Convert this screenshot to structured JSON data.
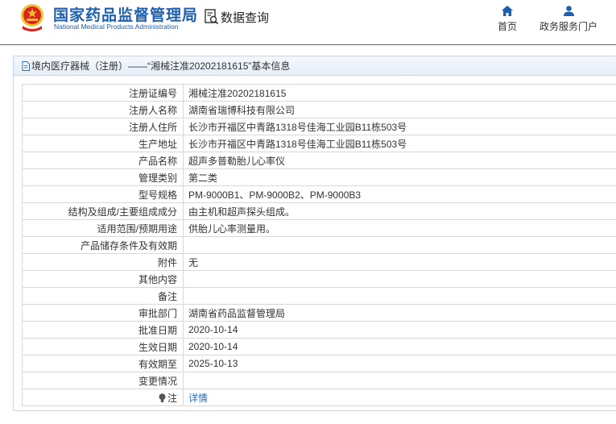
{
  "colors": {
    "brand": "#1d5fb0",
    "link": "#2a6ab8",
    "emblem_red": "#d9261c",
    "emblem_gold": "#f2c12e"
  },
  "header": {
    "org_name_cn": "国家药品监督管理局",
    "org_name_en": "National Medical Products Administration",
    "search_icon": "document-search-icon",
    "data_query": "数据查询",
    "nav": [
      {
        "icon": "home-icon",
        "label": "首页"
      },
      {
        "icon": "user-icon",
        "label": "政务服务门户"
      }
    ]
  },
  "panel": {
    "icon": "document-icon",
    "title": "境内医疗器械（注册）——“湘械注准20202181615”基本信息"
  },
  "rows": [
    {
      "label": "注册证编号",
      "value": "湘械注准20202181615"
    },
    {
      "label": "注册人名称",
      "value": "湖南省瑞博科技有限公司"
    },
    {
      "label": "注册人住所",
      "value": "长沙市开福区中青路1318号佳海工业园B11栋503号"
    },
    {
      "label": "生产地址",
      "value": "长沙市开福区中青路1318号佳海工业园B11栋503号"
    },
    {
      "label": "产品名称",
      "value": "超声多普勒胎儿心率仪"
    },
    {
      "label": "管理类别",
      "value": "第二类"
    },
    {
      "label": "型号规格",
      "value": "PM-9000B1、PM-9000B2、PM-9000B3"
    },
    {
      "label": "结构及组成/主要组成成分",
      "value": "由主机和超声探头组成。"
    },
    {
      "label": "适用范围/预期用途",
      "value": "供胎儿心率测量用。"
    },
    {
      "label": "产品储存条件及有效期",
      "value": ""
    },
    {
      "label": "附件",
      "value": "无"
    },
    {
      "label": "其他内容",
      "value": ""
    },
    {
      "label": "备注",
      "value": ""
    },
    {
      "label": "审批部门",
      "value": "湖南省药品监督管理局"
    },
    {
      "label": "批准日期",
      "value": "2020-10-14"
    },
    {
      "label": "生效日期",
      "value": "2020-10-14"
    },
    {
      "label": "有效期至",
      "value": "2025-10-13"
    },
    {
      "label": "变更情况",
      "value": ""
    }
  ],
  "note": {
    "icon": "lightbulb-icon",
    "label": "注",
    "link": "详情"
  }
}
